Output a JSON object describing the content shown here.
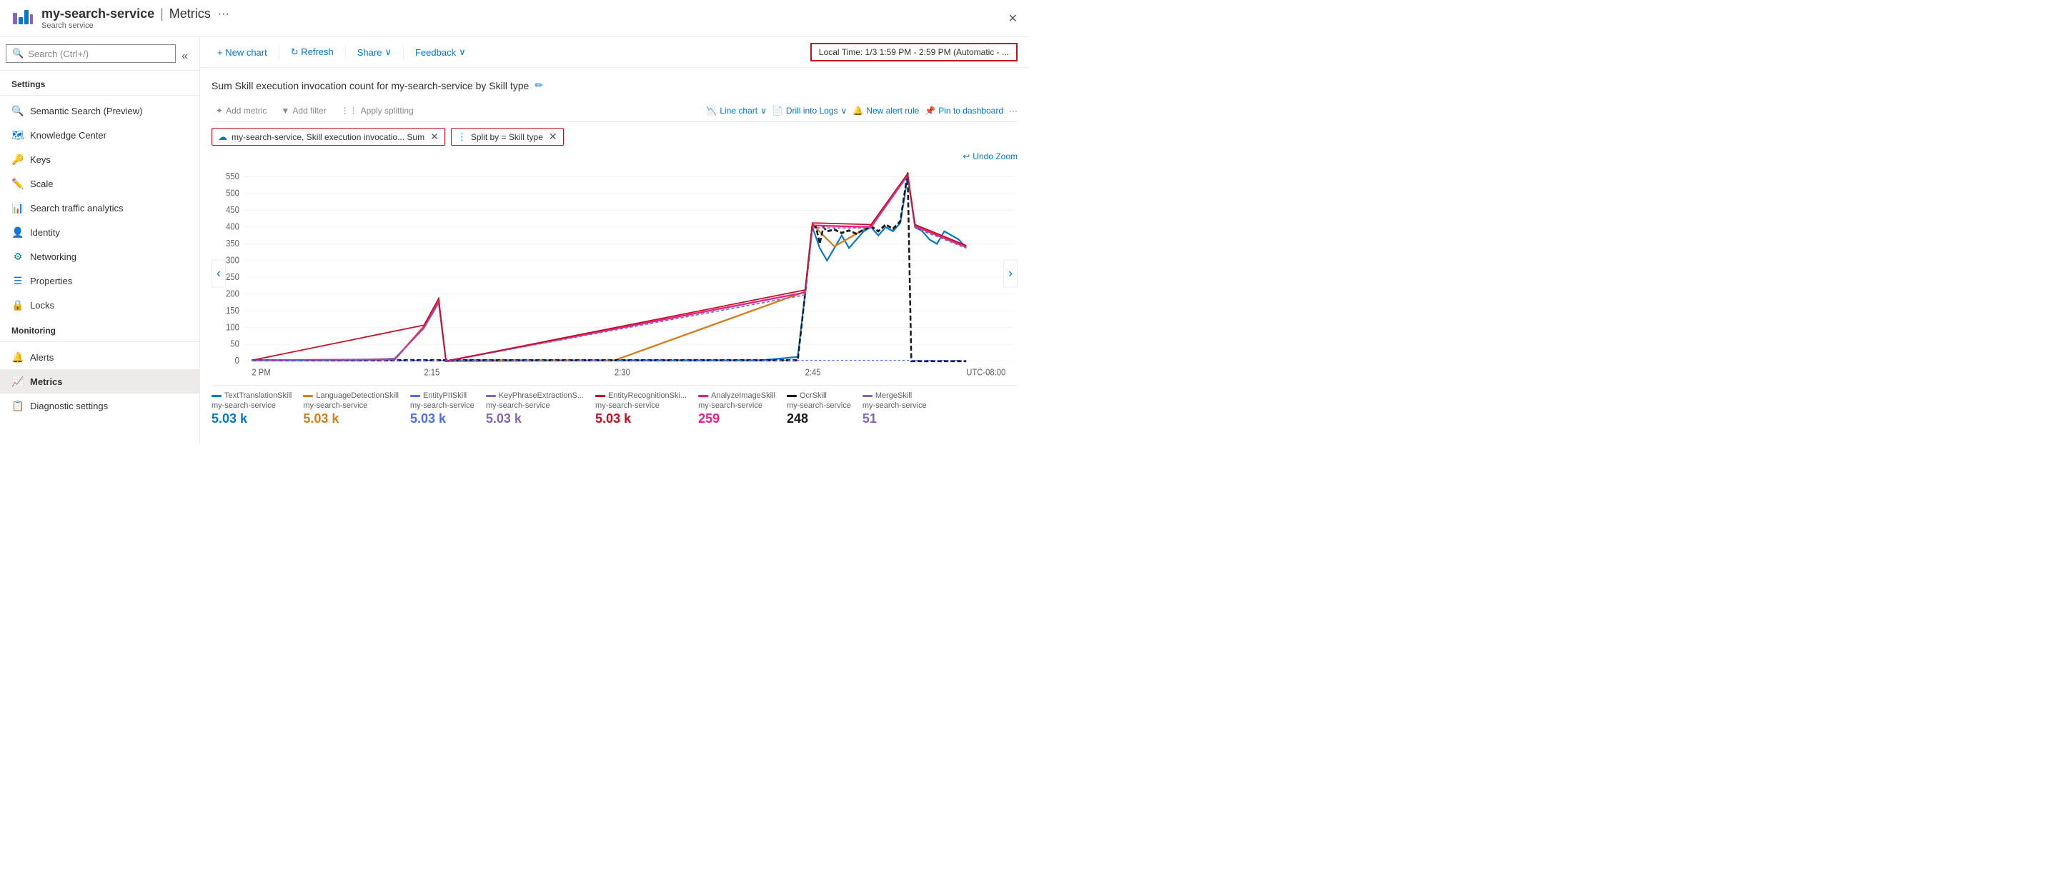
{
  "header": {
    "logo_color": "#8764b8",
    "service_name": "my-search-service",
    "page_title": "Metrics",
    "service_label": "Search service",
    "dots_label": "···",
    "close_label": "✕"
  },
  "sidebar": {
    "search_placeholder": "Search (Ctrl+/)",
    "settings_label": "Settings",
    "monitoring_label": "Monitoring",
    "items_settings": [
      {
        "id": "semantic-search",
        "label": "Semantic Search (Preview)",
        "icon": "🔍",
        "icon_class": "icon-blue"
      },
      {
        "id": "knowledge-center",
        "label": "Knowledge Center",
        "icon": "🗺",
        "icon_class": "icon-blue"
      },
      {
        "id": "keys",
        "label": "Keys",
        "icon": "🔑",
        "icon_class": "icon-gold"
      },
      {
        "id": "scale",
        "label": "Scale",
        "icon": "✏️",
        "icon_class": "icon-blue"
      },
      {
        "id": "search-traffic",
        "label": "Search traffic analytics",
        "icon": "📊",
        "icon_class": "icon-gray"
      },
      {
        "id": "identity",
        "label": "Identity",
        "icon": "👤",
        "icon_class": "icon-gold"
      },
      {
        "id": "networking",
        "label": "Networking",
        "icon": "⚙",
        "icon_class": "icon-teal"
      },
      {
        "id": "properties",
        "label": "Properties",
        "icon": "☰",
        "icon_class": "icon-blue"
      },
      {
        "id": "locks",
        "label": "Locks",
        "icon": "🔒",
        "icon_class": "icon-blue"
      }
    ],
    "items_monitoring": [
      {
        "id": "alerts",
        "label": "Alerts",
        "icon": "🔔",
        "icon_class": "icon-green",
        "active": false
      },
      {
        "id": "metrics",
        "label": "Metrics",
        "icon": "📈",
        "icon_class": "icon-purple",
        "active": true
      },
      {
        "id": "diagnostic",
        "label": "Diagnostic settings",
        "icon": "📋",
        "icon_class": "icon-green",
        "active": false
      }
    ]
  },
  "toolbar": {
    "new_chart_label": "+ New chart",
    "refresh_label": "↻ Refresh",
    "share_label": "Share",
    "feedback_label": "Feedback",
    "time_range_label": "Local Time: 1/3 1:59 PM - 2:59 PM (Automatic - ..."
  },
  "chart": {
    "title": "Sum Skill execution invocation count for my-search-service by Skill type",
    "add_metric_label": "Add metric",
    "add_filter_label": "Add filter",
    "apply_splitting_label": "Apply splitting",
    "line_chart_label": "Line chart",
    "drill_logs_label": "Drill into Logs",
    "new_alert_label": "New alert rule",
    "pin_dashboard_label": "Pin to dashboard",
    "more_label": "···",
    "undo_zoom_label": "Undo Zoom",
    "filter_tag1_text": "my-search-service, Skill execution invocatio... Sum",
    "filter_tag2_text": "Split by = Skill type",
    "y_axis": [
      "550",
      "500",
      "450",
      "400",
      "350",
      "300",
      "250",
      "200",
      "150",
      "100",
      "50",
      "0"
    ],
    "x_axis": [
      "2 PM",
      "2:15",
      "2:30",
      "2:45",
      "UTC-08:00"
    ]
  },
  "legend": [
    {
      "id": "text-translation",
      "name": "TextTranslationSkill",
      "service": "my-search-service",
      "value": "5.03 k",
      "color": "#0078d4"
    },
    {
      "id": "language-detection",
      "name": "LanguageDetectionSkill",
      "service": "my-search-service",
      "value": "5.03 k",
      "color": "#d67c1c"
    },
    {
      "id": "entity-pii",
      "name": "EntityPIISkill",
      "service": "my-search-service",
      "value": "5.03 k",
      "color": "#4c6ef5"
    },
    {
      "id": "key-phrase",
      "name": "KeyPhraseExtractionS...",
      "service": "my-search-service",
      "value": "5.03 k",
      "color": "#8764b8"
    },
    {
      "id": "entity-recognition",
      "name": "EntityRecognitionSki...",
      "service": "my-search-service",
      "value": "5.03 k",
      "color": "#c50f1f"
    },
    {
      "id": "analyze-image",
      "name": "AnalyzeImageSkill",
      "service": "my-search-service",
      "value": "259",
      "color": "#e91e8c"
    },
    {
      "id": "ocr-skill",
      "name": "OcrSkill",
      "service": "my-search-service",
      "value": "248",
      "color": "#1a1a1a"
    },
    {
      "id": "merge-skill",
      "name": "MergeSkill",
      "service": "my-search-service",
      "value": "51",
      "color": "#8764b8"
    }
  ]
}
